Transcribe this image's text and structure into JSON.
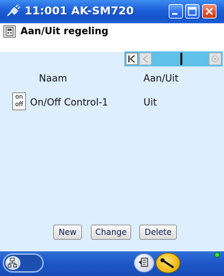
{
  "window": {
    "title": "11:001 AK-SM720"
  },
  "header": {
    "title": "Aan/Uit regeling"
  },
  "table": {
    "columns": [
      "Naam",
      "Aan/Uit"
    ],
    "rows": [
      {
        "badge_top": "on",
        "badge_bottom": "off",
        "name": "On/Off Control-1",
        "state": "Uit"
      }
    ]
  },
  "actions": {
    "new_label": "New",
    "change_label": "Change",
    "delete_label": "Delete"
  },
  "icons": {
    "title": "plug-icon",
    "header": "device-icon",
    "nav_first": "first-page-icon",
    "nav_prev": "prev-page-icon",
    "nav_next": "next-page-icon",
    "bottom_left": "network-tree-icon",
    "bottom_mid": "log-icon",
    "bottom_right": "service-key-icon",
    "status": "status-led-icon"
  },
  "colors": {
    "titlebar": "#1f63dc",
    "content_bg": "#ddeeff",
    "nav_strip": "#5fc0e8",
    "status_led": "#37e437"
  }
}
